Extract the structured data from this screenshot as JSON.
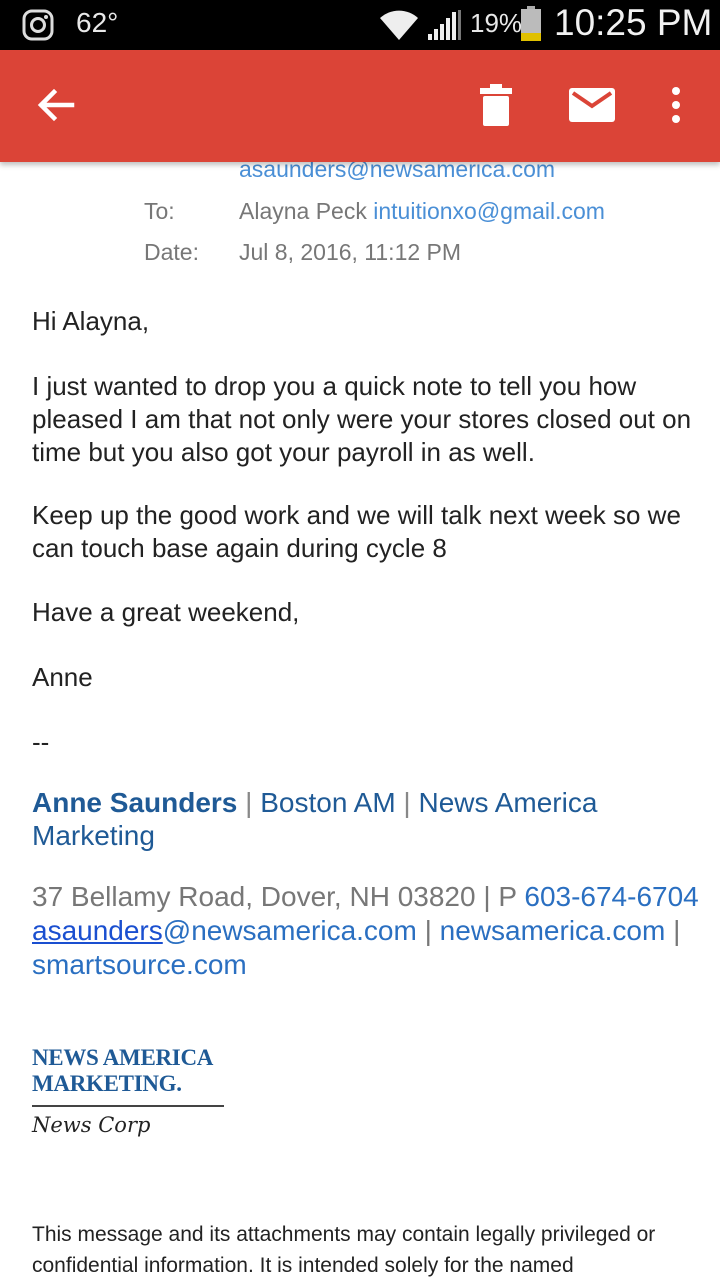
{
  "status_bar": {
    "temperature": "62°",
    "battery_percent": "19%",
    "time": "10:25 PM",
    "icons": [
      "instagram-icon",
      "wifi-icon",
      "signal-icon",
      "battery-icon"
    ]
  },
  "toolbar": {
    "color": "#db4437",
    "icons": [
      "back-arrow-icon",
      "delete-icon",
      "mail-icon",
      "more-vert-icon"
    ]
  },
  "header": {
    "from_email": "asaunders@newsamerica.com",
    "to_label": "To:",
    "to_name": "Alayna Peck",
    "to_email": "intuitionxo@gmail.com",
    "date_label": "Date:",
    "date_value": "Jul 8, 2016, 11:12 PM"
  },
  "message": {
    "greeting": "Hi Alayna,",
    "paragraph1": "I just wanted to drop you a quick note to tell you how pleased I am that not only were your stores closed out on time but you also got your payroll in as well.",
    "paragraph2": "Keep up the good work and we will talk next week so we can touch base again during cycle 8",
    "paragraph3": "Have a great weekend,",
    "signoff": "Anne",
    "separator": "--"
  },
  "signature": {
    "name": "Anne Saunders",
    "sep": "|",
    "office": "Boston AM",
    "company": "News America Marketing",
    "address": "37 Bellamy Road, Dover, NH  03820",
    "phone_prefix": "P",
    "phone": "603-674-6704",
    "email_user": "asaunders",
    "email_domain": "@newsamerica.com",
    "site1": "newsamerica.com",
    "site2": "smartsource.com",
    "logo_line1": "NEWS AMERICA",
    "logo_line2": "MARKETING.",
    "logo_sub": "News Corp"
  },
  "disclaimer": "This message and its attachments may contain legally privileged or confidential information. It is intended solely for the named"
}
